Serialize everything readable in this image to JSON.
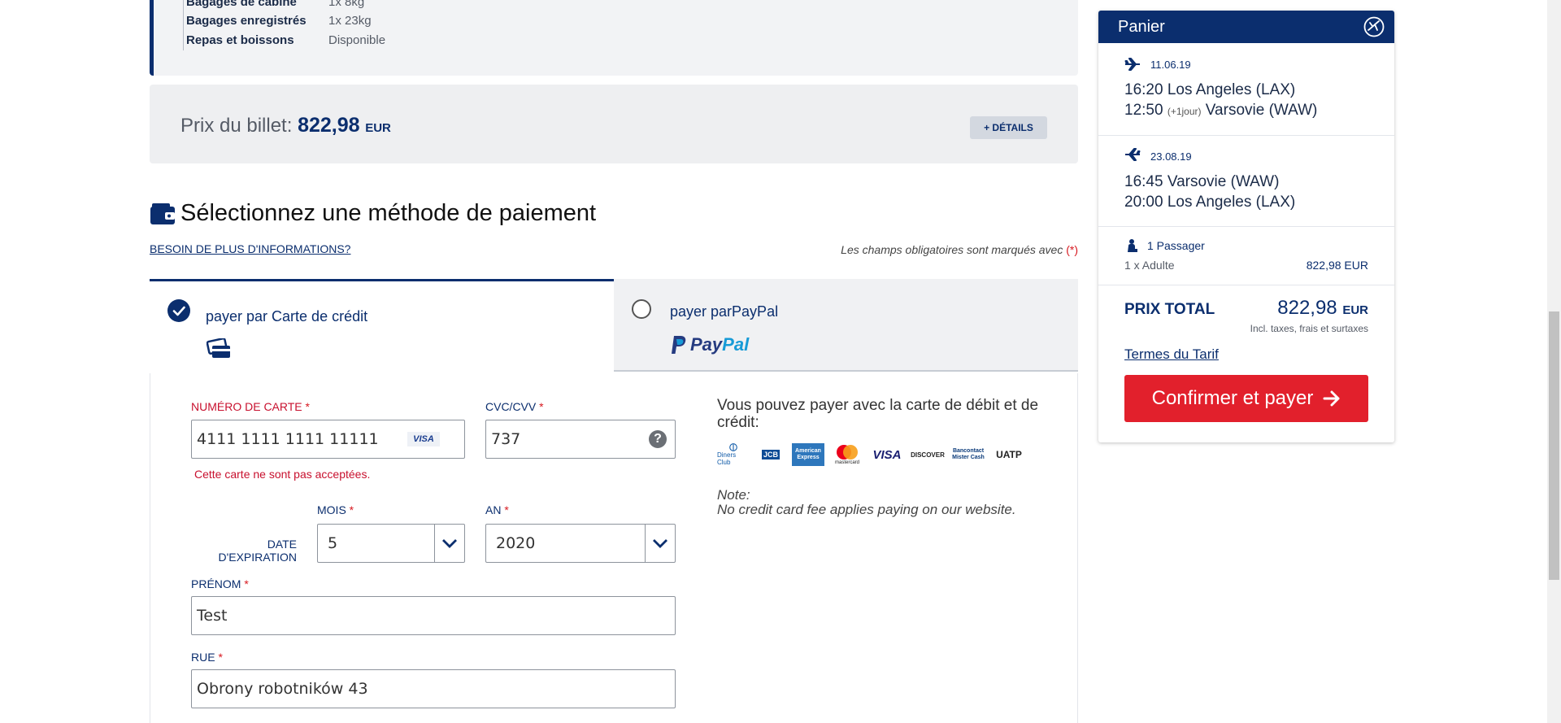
{
  "baggage": {
    "rows": [
      {
        "key": "Bagages de cabine",
        "value": "1x 8kg"
      },
      {
        "key": "Bagages enregistrés",
        "value": "1x 23kg"
      },
      {
        "key": "Repas et boissons",
        "value": "Disponible"
      }
    ]
  },
  "price": {
    "label": "Prix du billet:",
    "amount": "822,98",
    "currency": "EUR",
    "details_button": "+ DÉTAILS"
  },
  "payment": {
    "heading": "Sélectionnez une méthode de paiement",
    "more_info_link": "BESOIN DE PLUS D'INFORMATIONS?",
    "required_note": "Les champs obligatoires sont marqués avec",
    "required_marker": "(*)",
    "tabs": {
      "card": {
        "label": "payer par Carte de crédit",
        "selected": true
      },
      "paypal": {
        "label": "payer parPayPal",
        "logo_pay": "Pay",
        "logo_pal": "Pal",
        "selected": false
      }
    }
  },
  "form": {
    "card_number": {
      "label": "NUMÉRO DE CARTE",
      "value": "4111 1111 1111 11111",
      "brand": "VISA",
      "error": "Cette carte ne sont pas acceptées."
    },
    "cvc": {
      "label": "CVC/CVV",
      "value": "737",
      "help": "?"
    },
    "expiry_label_line1": "DATE",
    "expiry_label_line2": "D'EXPIRATION",
    "month": {
      "label": "MOIS",
      "value": "5"
    },
    "year": {
      "label": "AN",
      "value": "2020"
    },
    "first_name": {
      "label": "PRÉNOM",
      "value": "Test"
    },
    "street": {
      "label": "RUE",
      "value": "Obrony robotników 43"
    },
    "required_star": "*"
  },
  "accepted": {
    "text": "Vous pouvez payer avec la carte de débit et de crédit:",
    "logos": [
      "Diners Club",
      "JCB",
      "American Express",
      "mastercard",
      "VISA",
      "DISCOVER",
      "Bancontact Mister Cash",
      "UATP"
    ],
    "note_title": "Note:",
    "note_text": "No credit card fee applies paying on our website."
  },
  "cart": {
    "title": "Panier",
    "outbound": {
      "date": "11.06.19",
      "dep": "16:20 Los Angeles (LAX)",
      "arr_time": "12:50",
      "arr_plus": "(+1jour)",
      "arr_city": "Varsovie (WAW)"
    },
    "inbound": {
      "date": "23.08.19",
      "dep": "16:45 Varsovie (WAW)",
      "arr": "20:00 Los Angeles (LAX)"
    },
    "passengers": {
      "count": "1 Passager",
      "type": "1 x Adulte",
      "price": "822,98 EUR"
    },
    "total": {
      "label": "PRIX TOTAL",
      "amount": "822,98",
      "currency": "EUR",
      "note": "Incl. taxes, frais et surtaxes"
    },
    "tariff_link": "Termes du Tarif",
    "confirm_button": "Confirmer et payer"
  },
  "colors": {
    "brand_navy": "#0b2e6e",
    "cta_red": "#e2202c",
    "error_red": "#c8102e"
  }
}
